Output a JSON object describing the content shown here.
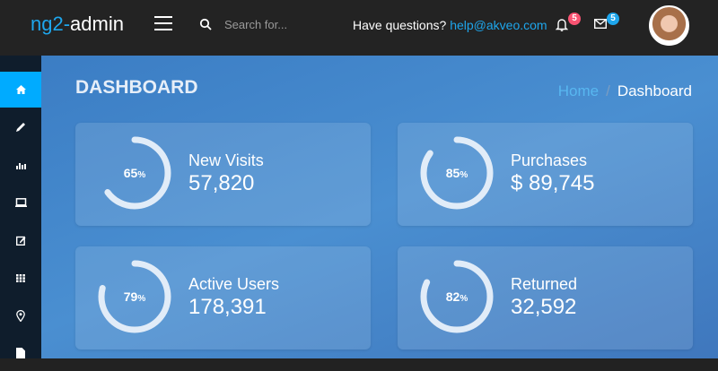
{
  "header": {
    "logo_prefix": "ng2-",
    "logo_suffix": "admin",
    "search_placeholder": "Search for...",
    "questions": "Have questions?",
    "email": "help@akveo.com",
    "notifications_count": "5",
    "messages_count": "5",
    "notif_color": "#f95372",
    "msg_color": "#1ea6ec"
  },
  "sidebar": {
    "items": [
      {
        "icon": "home-icon",
        "active": true
      },
      {
        "icon": "pencil-icon"
      },
      {
        "icon": "bar-chart-icon"
      },
      {
        "icon": "laptop-icon"
      },
      {
        "icon": "edit-icon"
      },
      {
        "icon": "grid-icon"
      },
      {
        "icon": "map-marker-icon"
      },
      {
        "icon": "file-icon"
      }
    ]
  },
  "main": {
    "title": "DASHBOARD",
    "breadcrumb": {
      "home": "Home",
      "separator": "/",
      "current": "Dashboard"
    }
  },
  "cards": [
    {
      "label": "New Visits",
      "value": "57,820",
      "percent": 65
    },
    {
      "label": "Purchases",
      "value": "$ 89,745",
      "percent": 85
    },
    {
      "label": "Active Users",
      "value": "178,391",
      "percent": 79
    },
    {
      "label": "Returned",
      "value": "32,592",
      "percent": 82
    }
  ]
}
